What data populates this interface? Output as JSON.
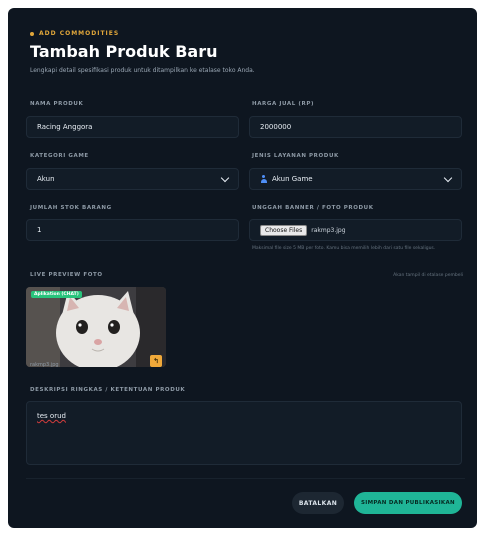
{
  "header": {
    "eyebrow": "ADD COMMODITIES",
    "title": "Tambah Produk Baru",
    "subtitle": "Lengkapi detail spesifikasi produk untuk ditampilkan ke etalase toko Anda."
  },
  "fields": {
    "name": {
      "label": "NAMA PRODUK",
      "value": "Racing Anggora"
    },
    "price": {
      "label": "HARGA JUAL (RP)",
      "value": "2000000"
    },
    "category": {
      "label": "KATEGORI GAME",
      "value": "Akun"
    },
    "service": {
      "label": "JENIS LAYANAN PRODUK",
      "value": "Akun Game"
    },
    "stock": {
      "label": "JUMLAH STOK BARANG",
      "value": "1"
    },
    "banner": {
      "label": "UNGGAH BANNER / FOTO PRODUK",
      "button": "Choose Files",
      "filename": "rakmp3.jpg",
      "hint": "Maksimal file size 5 MB per foto. Kamu bisa memilih lebih dari satu file sekaligus."
    }
  },
  "preview": {
    "label": "LIVE PREVIEW FOTO",
    "note": "Akan tampil di etalase pembeli",
    "badge": "Aplikation (CHAT)",
    "filename": "rakmp3.jpg",
    "edit_icon": "crop-icon"
  },
  "description": {
    "label": "DESKRIPSI RINGKAS / KETENTUAN PRODUK",
    "value": "tes orud"
  },
  "actions": {
    "cancel": "BATALKAN",
    "submit": "SIMPAN DAN PUBLIKASIKAN"
  },
  "colors": {
    "accent": "#e0a63a",
    "primary": "#1fb597",
    "background": "#0e1620"
  }
}
